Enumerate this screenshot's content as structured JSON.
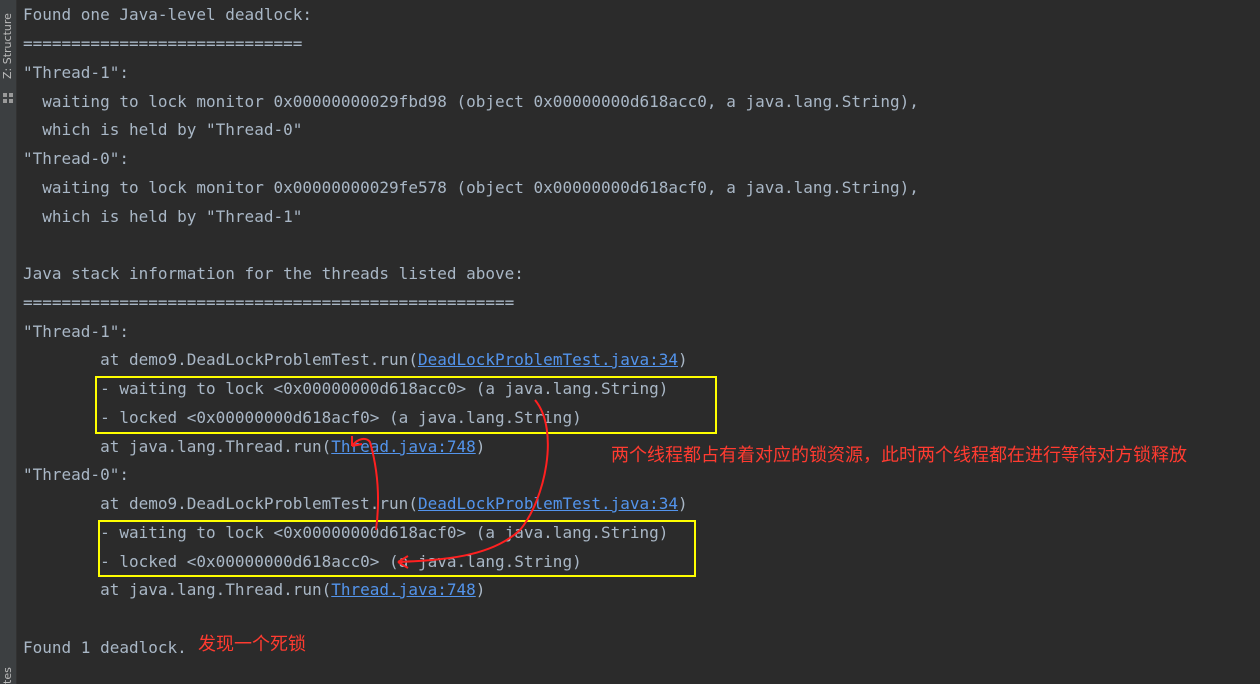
{
  "sidebar": {
    "structure_tab": "Z: Structure",
    "bottom_tab": "tes"
  },
  "console": {
    "l1": "Found one Java-level deadlock:",
    "l2": "=============================",
    "l3": "\"Thread-1\":",
    "l4": "  waiting to lock monitor 0x00000000029fbd98 (object 0x00000000d618acc0, a java.lang.String),",
    "l5": "  which is held by \"Thread-0\"",
    "l6": "\"Thread-0\":",
    "l7": "  waiting to lock monitor 0x00000000029fe578 (object 0x00000000d618acf0, a java.lang.String),",
    "l8": "  which is held by \"Thread-1\"",
    "l10": "Java stack information for the threads listed above:",
    "l11": "===================================================",
    "l12": "\"Thread-1\":",
    "t1_at1_pre": "        at demo9.DeadLockProblemTest.run(",
    "t1_at1_link": "DeadLockProblemTest.java:34",
    "t1_at1_post": ")",
    "t1_waiting": "        - waiting to lock <0x00000000d618acc0> (a java.lang.String)",
    "t1_locked": "        - locked <0x00000000d618acf0> (a java.lang.String)",
    "t1_at2_pre": "        at java.lang.Thread.run(",
    "t1_at2_link": "Thread.java:748",
    "t1_at2_post": ")",
    "l17": "\"Thread-0\":",
    "t0_at1_pre": "        at demo9.DeadLockProblemTest.run(",
    "t0_at1_link": "DeadLockProblemTest.java:34",
    "t0_at1_post": ")",
    "t0_waiting": "        - waiting to lock <0x00000000d618acf0> (a java.lang.String)",
    "t0_locked": "        - locked <0x00000000d618acc0> (a java.lang.String)",
    "t0_at2_pre": "        at java.lang.Thread.run(",
    "t0_at2_link": "Thread.java:748",
    "t0_at2_post": ")",
    "l23": "Found 1 deadlock."
  },
  "annotations": {
    "note_main": "两个线程都占有着对应的锁资源，此时两个线程都在进行等待对方锁释放",
    "note_found": "发现一个死锁"
  },
  "colors": {
    "background": "#2b2b2b",
    "text": "#a9b7c6",
    "link": "#5394ec",
    "highlight_box": "#ffff00",
    "annotation": "#ff3b30"
  }
}
